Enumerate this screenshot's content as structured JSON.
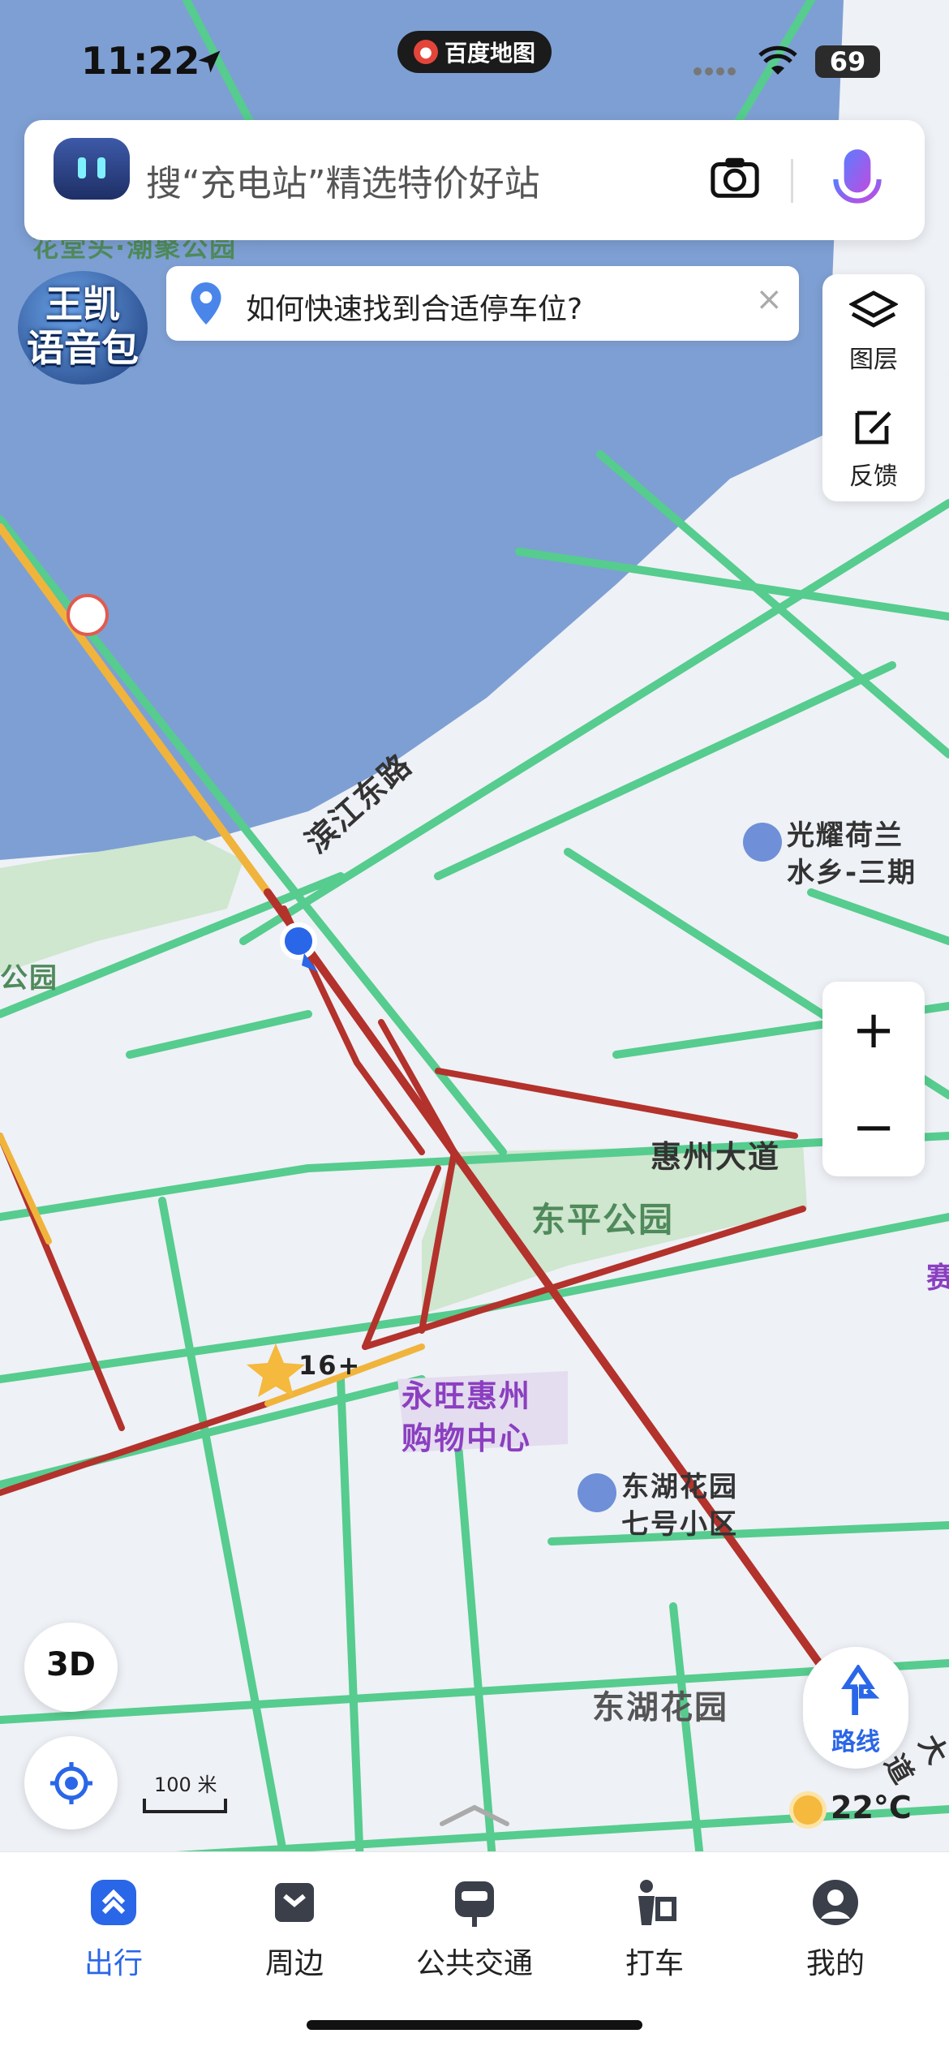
{
  "status_bar": {
    "time": "11:22",
    "app_name": "百度地图",
    "battery": "69"
  },
  "search": {
    "placeholder": "搜“充电站”精选特价好站"
  },
  "hint_banner": {
    "text": "如何快速找到合适停车位?",
    "close": "×"
  },
  "voice_pack": {
    "line1": "王凯",
    "line2": "语音包"
  },
  "side_panel": {
    "layers_label": "图层",
    "feedback_label": "反馈"
  },
  "zoom": {
    "in": "+",
    "out": "−"
  },
  "map_labels": {
    "road1": "滨江东路",
    "road2": "惠州大道",
    "park": "东平公园",
    "mall_line1": "永旺惠州",
    "mall_line2": "购物中心",
    "res1_line1": "东湖花园",
    "res1_line2": "七号小区",
    "res2": "东湖花园",
    "poi1_line1": "光耀荷兰",
    "poi1_line2": "水乡-三期",
    "park_top": "花堂头·潮聚公园",
    "park_left": "公园",
    "star_count": "16+",
    "partial_right": "赛",
    "partial_road": "大道"
  },
  "controls": {
    "btn_3d": "3D",
    "route_label": "路线",
    "scale": "100 米",
    "weather": "22°C"
  },
  "tabs": [
    {
      "label": "出行",
      "icon": "travel-icon",
      "active": true
    },
    {
      "label": "周边",
      "icon": "nearby-icon",
      "active": false
    },
    {
      "label": "公共交通",
      "icon": "bus-icon",
      "active": false
    },
    {
      "label": "打车",
      "icon": "taxi-icon",
      "active": false
    },
    {
      "label": "我的",
      "icon": "profile-icon",
      "active": false
    }
  ],
  "colors": {
    "water": "#7e9fd3",
    "land": "#eef1f6",
    "park": "#cfe6cf",
    "road_green": "#56cc8e",
    "road_red": "#b3322c",
    "road_yellow": "#f0b43c",
    "accent": "#2a66e8"
  }
}
